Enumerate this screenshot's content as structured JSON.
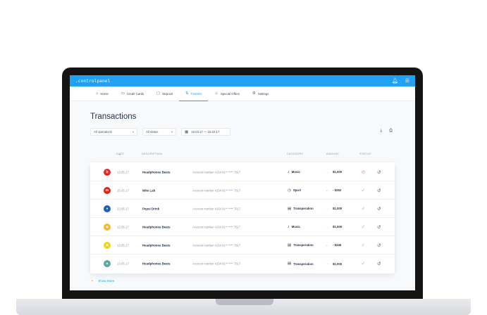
{
  "app": {
    "brand": ".controlpanel",
    "topbar_icons": [
      "bell-icon",
      "menu-icon"
    ]
  },
  "nav": {
    "items": [
      {
        "label": "Home",
        "icon": "home-icon",
        "glyph": "⌂",
        "active": false
      },
      {
        "label": "Credit Cards",
        "icon": "credit-card-icon",
        "glyph": "▭",
        "active": false
      },
      {
        "label": "Deposit",
        "icon": "deposit-icon",
        "glyph": "▢",
        "active": false
      },
      {
        "label": "Transfer",
        "icon": "transfer-icon",
        "glyph": "⇅",
        "active": true
      },
      {
        "label": "Special Offers",
        "icon": "smiley-icon",
        "glyph": "☺",
        "active": false
      },
      {
        "label": "Settings",
        "icon": "gear-icon",
        "glyph": "⚙",
        "active": false
      }
    ]
  },
  "page": {
    "title": "Transactions"
  },
  "filters": {
    "operations": "All operations",
    "status": "All status",
    "date_range": "10.03.17 — 16.03.17"
  },
  "table": {
    "headers": {
      "date": "DATE",
      "description": "DESCRIPTION",
      "category": "CATEGORY",
      "amount": "AMOUNT",
      "status": "STATUS"
    },
    "rows": [
      {
        "logo": "beats-logo",
        "logo_glyph": "b",
        "logo_color": "#e32b2b",
        "date": "13.05.17",
        "description": "Headphones Beats",
        "account": "Account number 4154 81** **** 7617",
        "category": "Music",
        "category_icon": "music-icon",
        "category_glyph": "♪",
        "direction": "in",
        "amount": "$1,000",
        "status": "pending"
      },
      {
        "logo": "nike-lab-logo",
        "logo_glyph": "m",
        "logo_color": "#d9261c",
        "date": "15.05.17",
        "description": "Nike Lab",
        "account": "Account number 4154 81** **** 7617",
        "category": "Sport",
        "category_icon": "sport-icon",
        "category_glyph": "◷",
        "direction": "out",
        "amount": "- $262",
        "status": "done"
      },
      {
        "logo": "pepsi-logo",
        "logo_glyph": "●",
        "logo_color": "#1c5fb8",
        "date": "13.05.17",
        "description": "Pepsi Drink",
        "account": "Account number 4154 81** **** 7617",
        "category": "Transperation",
        "category_icon": "bus-icon",
        "category_glyph": "▤",
        "direction": "in",
        "amount": "$1,000",
        "status": "done"
      },
      {
        "logo": "sketch-logo",
        "logo_glyph": "◆",
        "logo_color": "#f7b52c",
        "date": "13.05.17",
        "description": "Headphones Beats",
        "account": "Account number 4154 81** **** 7617",
        "category": "Music",
        "category_icon": "music-icon",
        "category_glyph": "♪",
        "direction": "in",
        "amount": "$1,000",
        "status": "done"
      },
      {
        "logo": "smiley-logo",
        "logo_glyph": "☻",
        "logo_color": "#f4d21f",
        "date": "13.05.17",
        "description": "Headphones Beats",
        "account": "Account number 4154 81** **** 7617",
        "category": "Transperation",
        "category_icon": "bus-icon",
        "category_glyph": "▤",
        "direction": "out",
        "amount": "- $246",
        "status": "done"
      },
      {
        "logo": "landscape-logo",
        "logo_glyph": "▲",
        "logo_color": "#5fa8a0",
        "date": "13.05.17",
        "description": "Headphones Beats",
        "account": "Account number 4154 81** **** 7617",
        "category": "Transperation",
        "category_icon": "bus-icon",
        "category_glyph": "▤",
        "direction": "in",
        "amount": "$1,000",
        "status": "done"
      }
    ]
  },
  "show_more": {
    "label": "Show More"
  },
  "colors": {
    "accent": "#1fa2f4",
    "in_arrow": "#f4b41f",
    "out_arrow": "#e8606a",
    "done": "#6ccb4d",
    "pending": "#e8606a"
  }
}
